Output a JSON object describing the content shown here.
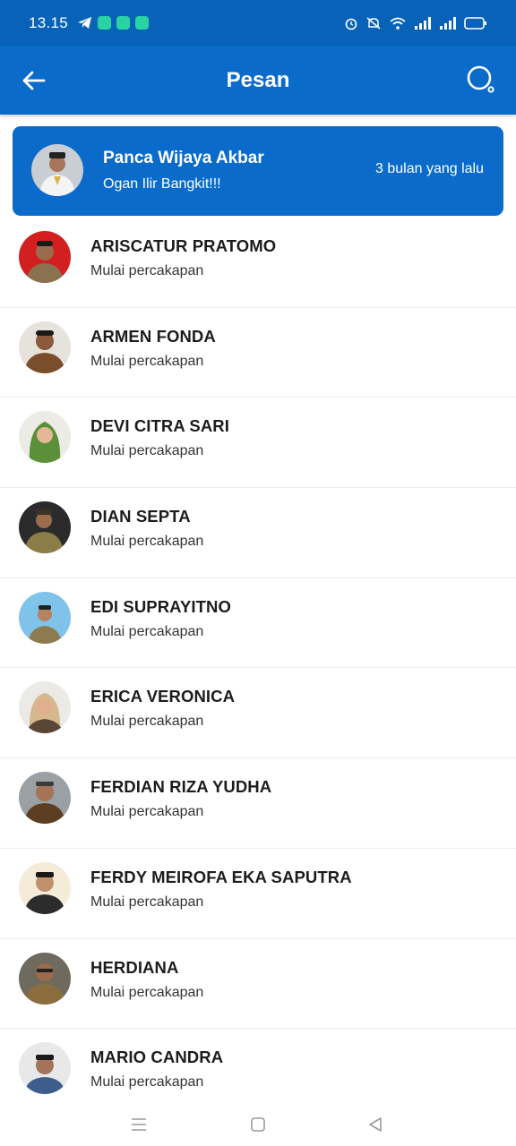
{
  "status_bar": {
    "time": "13.15",
    "left_icons": [
      "telegram-icon",
      "app-icon",
      "phone-app-icon",
      "chat-app-icon"
    ],
    "right_icons": [
      "alarm-icon",
      "mute-icon",
      "wifi-icon",
      "signal-icon",
      "signal-icon-2",
      "battery-icon"
    ]
  },
  "header": {
    "title": "Pesan"
  },
  "featured": {
    "name": "Panca Wijaya Akbar",
    "message": "Ogan Ilir Bangkit!!!",
    "time": "3 bulan yang lalu"
  },
  "contacts": [
    {
      "name": "ARISCATUR PRATOMO",
      "subtitle": "Mulai percakapan"
    },
    {
      "name": "ARMEN FONDA",
      "subtitle": "Mulai percakapan"
    },
    {
      "name": "DEVI CITRA SARI",
      "subtitle": "Mulai percakapan"
    },
    {
      "name": "DIAN SEPTA",
      "subtitle": "Mulai percakapan"
    },
    {
      "name": "EDI SUPRAYITNO",
      "subtitle": "Mulai percakapan"
    },
    {
      "name": "ERICA VERONICA",
      "subtitle": "Mulai percakapan"
    },
    {
      "name": "FERDIAN RIZA YUDHA",
      "subtitle": "Mulai percakapan"
    },
    {
      "name": "FERDY MEIROFA EKA SAPUTRA",
      "subtitle": "Mulai percakapan"
    },
    {
      "name": "HERDIANA",
      "subtitle": "Mulai percakapan"
    },
    {
      "name": "MARIO CANDRA",
      "subtitle": "Mulai percakapan"
    }
  ],
  "colors": {
    "status_bar": "#0863b8",
    "app_bar": "#0b6bcb",
    "text_dark": "#1c1c1c"
  }
}
